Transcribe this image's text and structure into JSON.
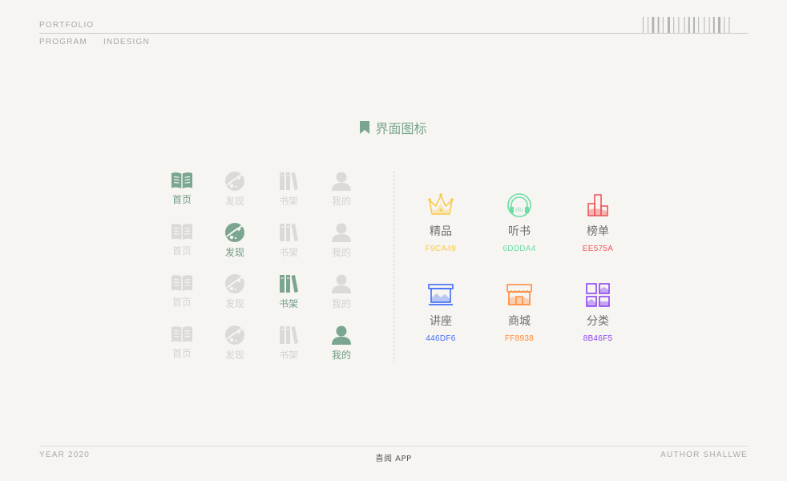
{
  "header": {
    "portfolio": "PORTFOLIO",
    "program": "PROGRAM",
    "indesign": "INDESIGN"
  },
  "section": {
    "title": "界面图标",
    "accent": "#7aa590"
  },
  "tabbar": {
    "active_color": "#7aa590",
    "inactive_color": "#dcdad7",
    "rows": [
      {
        "active": 0,
        "items": [
          {
            "label": "首页",
            "icon": "book-icon"
          },
          {
            "label": "发现",
            "icon": "planet-icon"
          },
          {
            "label": "书架",
            "icon": "bookshelf-icon"
          },
          {
            "label": "我的",
            "icon": "user-icon"
          }
        ]
      },
      {
        "active": 1,
        "items": [
          {
            "label": "首页",
            "icon": "book-icon"
          },
          {
            "label": "发现",
            "icon": "planet-icon"
          },
          {
            "label": "书架",
            "icon": "bookshelf-icon"
          },
          {
            "label": "我的",
            "icon": "user-icon"
          }
        ]
      },
      {
        "active": 2,
        "items": [
          {
            "label": "首页",
            "icon": "book-icon"
          },
          {
            "label": "发现",
            "icon": "planet-icon"
          },
          {
            "label": "书架",
            "icon": "bookshelf-icon"
          },
          {
            "label": "我的",
            "icon": "user-icon"
          }
        ]
      },
      {
        "active": 3,
        "items": [
          {
            "label": "首页",
            "icon": "book-icon"
          },
          {
            "label": "发现",
            "icon": "planet-icon"
          },
          {
            "label": "书架",
            "icon": "bookshelf-icon"
          },
          {
            "label": "我的",
            "icon": "user-icon"
          }
        ]
      }
    ]
  },
  "features": [
    {
      "label": "精品",
      "code": "F9CA49",
      "color": "#F9CA49",
      "icon": "crown-icon"
    },
    {
      "label": "听书",
      "code": "6DDDA4",
      "color": "#6DDDA4",
      "icon": "headphones-icon"
    },
    {
      "label": "榜单",
      "code": "EE575A",
      "color": "#EE575A",
      "icon": "ranking-icon"
    },
    {
      "label": "讲座",
      "code": "446DF6",
      "color": "#446DF6",
      "icon": "lecture-icon"
    },
    {
      "label": "商城",
      "code": "FF8938",
      "color": "#FF8938",
      "icon": "shop-icon"
    },
    {
      "label": "分类",
      "code": "8B46F5",
      "color": "#8B46F5",
      "icon": "category-icon"
    }
  ],
  "footer": {
    "year": "YEAR   2020",
    "app": "喜阅 APP",
    "author": "AUTHOR   SHALLWE"
  }
}
